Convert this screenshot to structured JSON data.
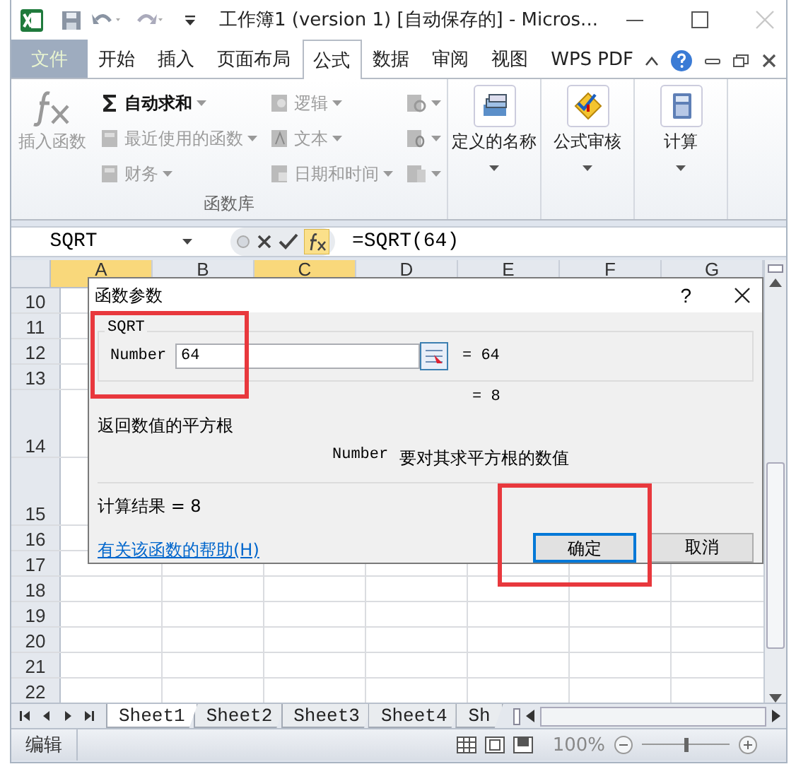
{
  "window": {
    "title": "工作簿1 (version 1) [自动保存的]  -  Micros..."
  },
  "ribbon_tabs": [
    {
      "label": "文件",
      "kind": "file",
      "selected": false
    },
    {
      "label": "开始",
      "kind": "tab",
      "selected": false
    },
    {
      "label": "插入",
      "kind": "tab",
      "selected": false
    },
    {
      "label": "页面布局",
      "kind": "tab",
      "selected": false
    },
    {
      "label": "公式",
      "kind": "tab",
      "selected": true
    },
    {
      "label": "数据",
      "kind": "tab",
      "selected": false
    },
    {
      "label": "审阅",
      "kind": "tab",
      "selected": false
    },
    {
      "label": "视图",
      "kind": "tab",
      "selected": false
    },
    {
      "label": "WPS PDF",
      "kind": "tab",
      "selected": false
    }
  ],
  "ribbon": {
    "insert_function": {
      "label": "插入函数",
      "enabled": false
    },
    "columns": [
      [
        {
          "label": "自动求和",
          "enabled": true
        },
        {
          "label": "最近使用的函数",
          "enabled": false
        },
        {
          "label": "财务",
          "enabled": false
        }
      ],
      [
        {
          "label": "逻辑",
          "enabled": false
        },
        {
          "label": "文本",
          "enabled": false
        },
        {
          "label": "日期和时间",
          "enabled": false
        }
      ]
    ],
    "group_label": "函数库",
    "big_buttons": [
      {
        "label": "定义的名称"
      },
      {
        "label": "公式审核"
      },
      {
        "label": "计算"
      }
    ]
  },
  "formula_bar": {
    "name_box": "SQRT",
    "formula": "=SQRT(64)"
  },
  "sheet": {
    "columns": [
      {
        "label": "A",
        "highlighted": true
      },
      {
        "label": "B",
        "highlighted": false
      },
      {
        "label": "C",
        "highlighted": true
      },
      {
        "label": "D",
        "highlighted": false
      },
      {
        "label": "E",
        "highlighted": false
      },
      {
        "label": "F",
        "highlighted": false
      },
      {
        "label": "G",
        "highlighted": false
      }
    ],
    "rows": [
      {
        "label": "10",
        "kind": "normal"
      },
      {
        "label": "11",
        "kind": "normal"
      },
      {
        "label": "12",
        "kind": "normal"
      },
      {
        "label": "13",
        "kind": "normal"
      },
      {
        "label": "14",
        "kind": "tall"
      },
      {
        "label": "15",
        "kind": "tall"
      },
      {
        "label": "16",
        "kind": "normal"
      },
      {
        "label": "17",
        "kind": "normal"
      },
      {
        "label": "18",
        "kind": "normal"
      },
      {
        "label": "19",
        "kind": "normal"
      },
      {
        "label": "20",
        "kind": "normal"
      },
      {
        "label": "21",
        "kind": "normal"
      },
      {
        "label": "22",
        "kind": "normal"
      }
    ]
  },
  "dialog": {
    "title": "函数参数",
    "help": "?",
    "function_name": "SQRT",
    "arguments": [
      {
        "label": "Number",
        "value": "64",
        "result": "= 64"
      }
    ],
    "preview": "= 8",
    "description": "返回数值的平方根",
    "argument_help": {
      "name": "Number",
      "text": "要对其求平方根的数值"
    },
    "result": "计算结果 = 8",
    "help_link": "有关该函数的帮助(H)",
    "buttons": [
      {
        "label": "确定",
        "default": true
      },
      {
        "label": "取消",
        "default": false
      }
    ]
  },
  "sheet_tabs": [
    {
      "label": "Sheet1",
      "selected": true
    },
    {
      "label": "Sheet2",
      "selected": false
    },
    {
      "label": "Sheet3",
      "selected": false
    },
    {
      "label": "Sheet4",
      "selected": false
    },
    {
      "label": "Sh",
      "selected": false
    }
  ],
  "status_bar": {
    "mode": "编辑",
    "zoom": "100%",
    "zoom_slider": {
      "level": 0.5
    }
  },
  "annotations": [
    {
      "kind": "frame"
    },
    {
      "kind": "frame"
    }
  ]
}
